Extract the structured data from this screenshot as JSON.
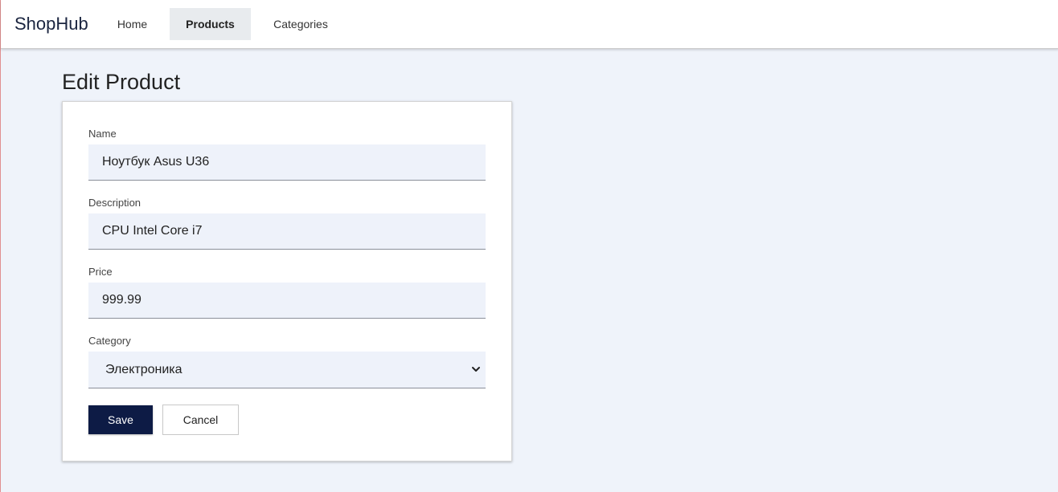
{
  "navbar": {
    "brand": "ShopHub",
    "items": [
      {
        "label": "Home",
        "active": false
      },
      {
        "label": "Products",
        "active": true
      },
      {
        "label": "Categories",
        "active": false
      }
    ]
  },
  "page": {
    "title": "Edit Product"
  },
  "form": {
    "name": {
      "label": "Name",
      "value": "Ноутбук Asus U36"
    },
    "description": {
      "label": "Description",
      "value": "CPU Intel Core i7"
    },
    "price": {
      "label": "Price",
      "value": "999.99"
    },
    "category": {
      "label": "Category",
      "selected": "Электроника"
    },
    "save_label": "Save",
    "cancel_label": "Cancel"
  },
  "colors": {
    "background": "#eff3fa",
    "primary_button": "#0d1b45",
    "input_background": "#eef2fa",
    "active_nav_background": "#e8ebee"
  }
}
